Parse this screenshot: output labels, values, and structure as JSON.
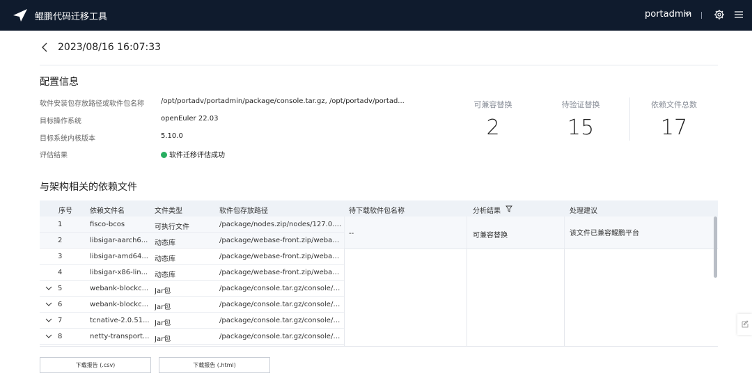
{
  "app": {
    "title": "鲲鹏代码迁移工具",
    "user": "portadmin"
  },
  "header": {
    "timestamp": "2023/08/16 16:07:33"
  },
  "config": {
    "title": "配置信息",
    "rows": [
      {
        "label": "软件安装包存放路径或软件包名称",
        "value": "/opt/portadv/portadmin/package/console.tar.gz, /opt/portadv/portad..."
      },
      {
        "label": "目标操作系统",
        "value": "openEuler 22.03"
      },
      {
        "label": "目标系统内核版本",
        "value": "5.10.0"
      },
      {
        "label": "评估结果",
        "value": "软件迁移评估成功"
      }
    ]
  },
  "stats": [
    {
      "label": "可兼容替换",
      "value": "2"
    },
    {
      "label": "待验证替换",
      "value": "15"
    },
    {
      "label": "依赖文件总数",
      "value": "17"
    }
  ],
  "deps": {
    "title": "与架构相关的依赖文件",
    "columns": [
      "序号",
      "依赖文件名",
      "文件类型",
      "软件包存放路径",
      "待下载软件包名称",
      "分析结果",
      "处理建议"
    ],
    "rows": [
      {
        "no": "1",
        "name": "fisco-bcos",
        "type": "可执行文件",
        "path": "/package/nodes.zip/nodes/127.0.0....",
        "expand": false
      },
      {
        "no": "2",
        "name": "libsigar-aarch6...",
        "type": "动态库",
        "path": "/package/webase-front.zip/webase-...",
        "expand": false
      },
      {
        "no": "3",
        "name": "libsigar-amd64...",
        "type": "动态库",
        "path": "/package/webase-front.zip/webase-...",
        "expand": false
      },
      {
        "no": "4",
        "name": "libsigar-x86-lin...",
        "type": "动态库",
        "path": "/package/webase-front.zip/webase-...",
        "expand": false
      },
      {
        "no": "5",
        "name": "webank-blockc...",
        "type": "Jar包",
        "path": "/package/console.tar.gz/console/lib...",
        "expand": true
      },
      {
        "no": "6",
        "name": "webank-blockc...",
        "type": "Jar包",
        "path": "/package/console.tar.gz/console/lib...",
        "expand": true
      },
      {
        "no": "7",
        "name": "tcnative-2.0.51...",
        "type": "Jar包",
        "path": "/package/console.tar.gz/console/lib...",
        "expand": true
      },
      {
        "no": "8",
        "name": "netty-transport...",
        "type": "Jar包",
        "path": "/package/console.tar.gz/console/lib...",
        "expand": true
      }
    ],
    "merged": {
      "download": "--",
      "result": "可兼容替换",
      "advice": "该文件已兼容鲲鹏平台"
    }
  },
  "buttons": {
    "csv": "下载报告 (.csv)",
    "html": "下载报告 (.html)"
  },
  "colors": {
    "topbar": "#0f1b2d",
    "success": "#27ae60",
    "header_bg": "#eef2f7"
  }
}
